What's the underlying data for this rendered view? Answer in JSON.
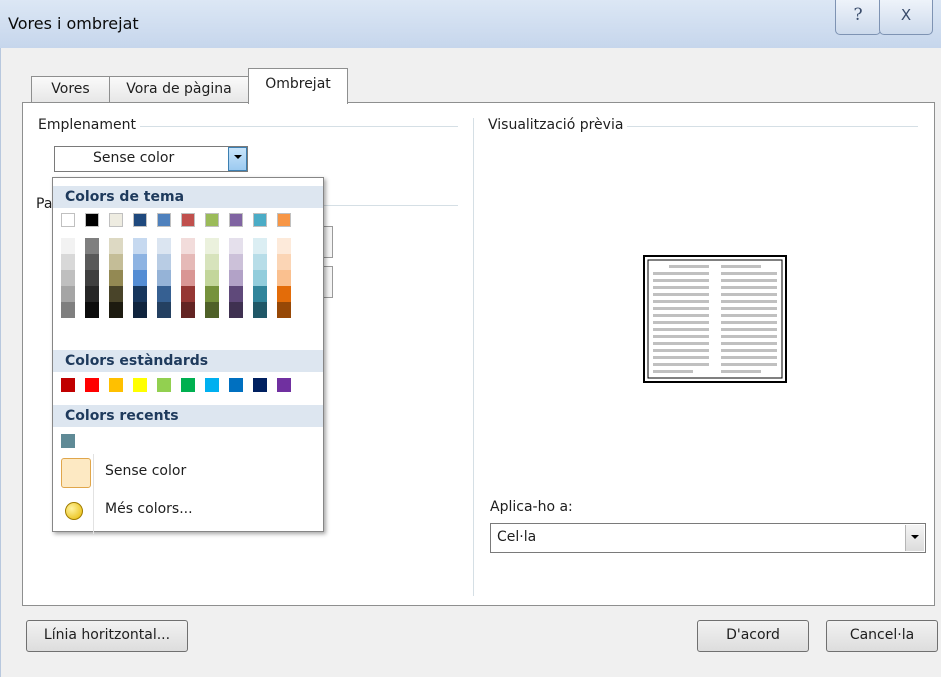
{
  "window": {
    "title": "Vores i ombrejat",
    "help_glyph": "?",
    "close_glyph": "X"
  },
  "tabs": [
    {
      "label": "Vores",
      "selected": false
    },
    {
      "label": "Vora de pàgina",
      "selected": false
    },
    {
      "label": "Ombrejat",
      "selected": true
    }
  ],
  "fill": {
    "group_label": "Emplenament",
    "combo_value": "Sense color",
    "pattern_partial_label": "Pa"
  },
  "popup": {
    "theme_header": "Colors de tema",
    "standard_header": "Colors estàndards",
    "recent_header": "Colors recents",
    "no_color_label": "Sense color",
    "more_colors_label": "Més colors...",
    "theme_top": [
      "#ffffff",
      "#000000",
      "#eeece1",
      "#1f497d",
      "#4f81bd",
      "#c0504d",
      "#9bbb59",
      "#8064a2",
      "#4bacc6",
      "#f79646"
    ],
    "theme_shades": [
      [
        "#f2f2f2",
        "#d8d8d8",
        "#bfbfbf",
        "#a5a5a5",
        "#7f7f7f"
      ],
      [
        "#7f7f7f",
        "#595959",
        "#3f3f3f",
        "#262626",
        "#0c0c0c"
      ],
      [
        "#ddd9c3",
        "#c4bd97",
        "#938953",
        "#494429",
        "#1d1b10"
      ],
      [
        "#c6d9f0",
        "#8db3e2",
        "#548dd4",
        "#17365d",
        "#0f243e"
      ],
      [
        "#dbe5f1",
        "#b8cce4",
        "#95b3d7",
        "#366092",
        "#244061"
      ],
      [
        "#f2dcdb",
        "#e5b9b7",
        "#d99694",
        "#953734",
        "#632423"
      ],
      [
        "#ebf1dd",
        "#d7e3bc",
        "#c3d69b",
        "#76923c",
        "#4f6128"
      ],
      [
        "#e5e0ec",
        "#ccc1d9",
        "#b2a2c7",
        "#5f497a",
        "#3f3151"
      ],
      [
        "#dbeef3",
        "#b7dde8",
        "#92cddc",
        "#31859b",
        "#205867"
      ],
      [
        "#fdeada",
        "#fbd5b5",
        "#fac08f",
        "#e36c09",
        "#974806"
      ]
    ],
    "standard": [
      "#c00000",
      "#ff0000",
      "#ffc000",
      "#ffff00",
      "#92d050",
      "#00b050",
      "#00b0f0",
      "#0070c0",
      "#002060",
      "#7030a0"
    ],
    "recent": [
      "#5f8a96"
    ]
  },
  "preview": {
    "label": "Visualització prèvia"
  },
  "apply": {
    "label": "Aplica-ho a:",
    "value": "Cel·la"
  },
  "buttons": {
    "horizontal_line": "Línia horitzontal...",
    "ok": "D'acord",
    "cancel": "Cancel·la"
  }
}
